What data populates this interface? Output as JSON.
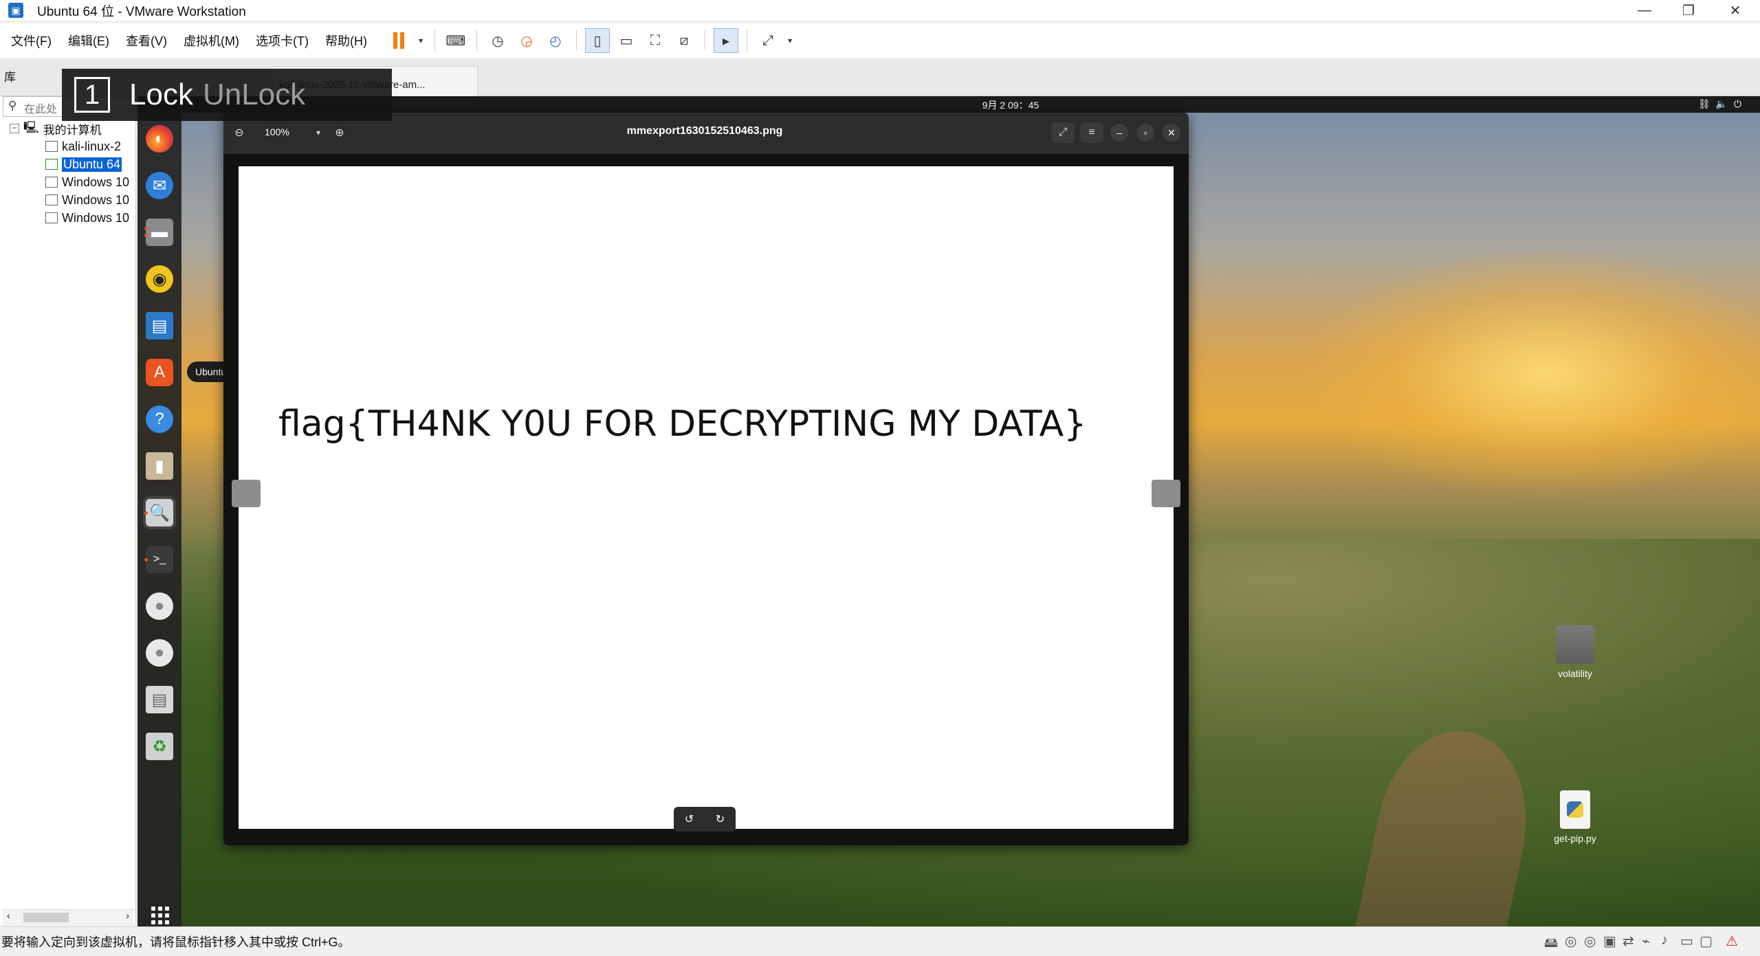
{
  "window": {
    "title": "Ubuntu 64 位 - VMware Workstation",
    "minimize_glyph": "—",
    "restore_glyph": "❐",
    "close_glyph": "✕"
  },
  "menu": [
    "文件(F)",
    "编辑(E)",
    "查看(V)",
    "虚拟机(M)",
    "选项卡(T)",
    "帮助(H)"
  ],
  "toolbar_icons": [
    "pause-icon",
    "send-ctrl-alt-del-icon",
    "snapshot-icon",
    "revert-snapshot-icon",
    "snapshot-manager-icon",
    "library-view-icon",
    "thumbnail-view-icon",
    "full-screen-icon",
    "unity-icon",
    "console-icon",
    "stretch-icon"
  ],
  "library": {
    "label": "库",
    "search_placeholder": "在此处",
    "root": "我的计算机",
    "items": [
      "kali-linux-2",
      "Ubuntu 64",
      "Windows 10",
      "Windows 10",
      "Windows 10"
    ],
    "selected_index": 1
  },
  "tab": {
    "label": "kali-linux-2025.1c-vmware-am..."
  },
  "lock_overlay": {
    "number": "1",
    "lock": "Lock",
    "unlock": "UnLock"
  },
  "guest": {
    "clock": "9月 2  09：45",
    "dock_tooltip": "Ubuntu Software",
    "viewer": {
      "filename": "mmexport1630152510463.png",
      "zoom": "100%",
      "image_text": "flag{TH4NK Y0U FOR DECRYPTING MY DATA}"
    },
    "desktop_icons": [
      "volatility",
      "get-pip.py"
    ]
  },
  "statusbar": {
    "text": "要将输入定向到该虚拟机，请将鼠标指针移入其中或按 Ctrl+G。"
  },
  "colors": {
    "selection": "#0a64d8",
    "pause": "#f07f12",
    "ubuntu_orange": "#e95420"
  }
}
